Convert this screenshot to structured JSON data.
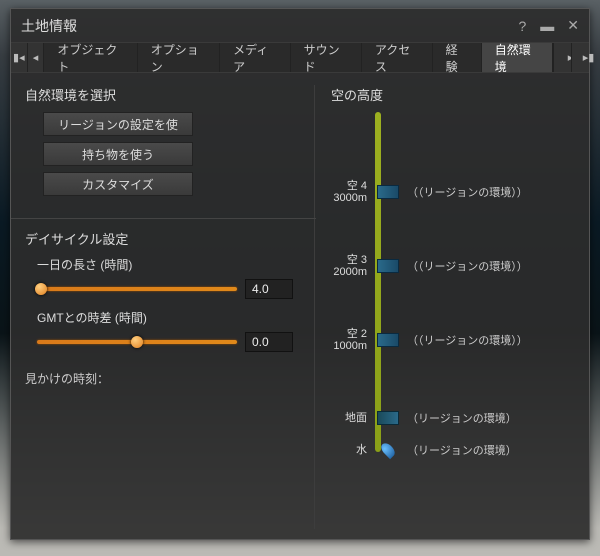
{
  "window": {
    "title": "土地情報"
  },
  "tabs": {
    "t0": "オブジェクト",
    "t1": "オプション",
    "t2": "メディア",
    "t3": "サウンド",
    "t4": "アクセス",
    "t5": "経験",
    "t6": "自然環境"
  },
  "env": {
    "select_label": "自然環境を選択",
    "use_region": "リージョンの設定を使",
    "use_inventory": "持ち物を使う",
    "customize": "カスタマイズ"
  },
  "daycycle": {
    "title": "デイサイクル設定",
    "length_label": "一日の長さ (時間)",
    "length_value": "4.0",
    "offset_label": "GMTとの時差 (時間)",
    "offset_value": "0.0",
    "apparent_label": "見かけの時刻："
  },
  "sky": {
    "title": "空の高度",
    "items": {
      "sky4": {
        "name": "空 4",
        "alt": "3000m",
        "env": "（（リージョンの環境））"
      },
      "sky3": {
        "name": "空 3",
        "alt": "2000m",
        "env": "（（リージョンの環境））"
      },
      "sky2": {
        "name": "空 2",
        "alt": "1000m",
        "env": "（（リージョンの環境））"
      },
      "ground": {
        "name": "地面",
        "env": "（リージョンの環境）"
      },
      "water": {
        "name": "水",
        "env": "（リージョンの環境）"
      }
    }
  }
}
